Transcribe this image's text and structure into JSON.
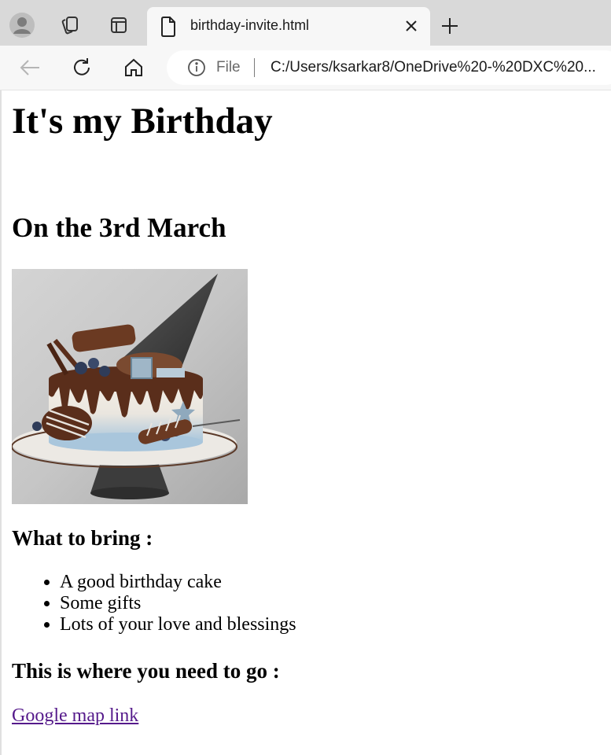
{
  "browser": {
    "tab": {
      "title": "birthday-invite.html"
    },
    "address": {
      "scheme_label": "File",
      "url": "C:/Users/ksarkar8/OneDrive%20-%20DXC%20..."
    }
  },
  "page": {
    "title": "It's my Birthday",
    "date_heading": "On the 3rd March",
    "bring_heading": "What to bring :",
    "bring_items": [
      "A good birthday cake",
      "Some gifts",
      "Lots of your love and blessings"
    ],
    "go_heading": "This is where you need to go :",
    "map_link": "Google map link"
  },
  "colors": {
    "tabbar_bg": "#d9d9d9",
    "toolbar_bg": "#f7f7f7",
    "link_visited": "#551a8b"
  }
}
